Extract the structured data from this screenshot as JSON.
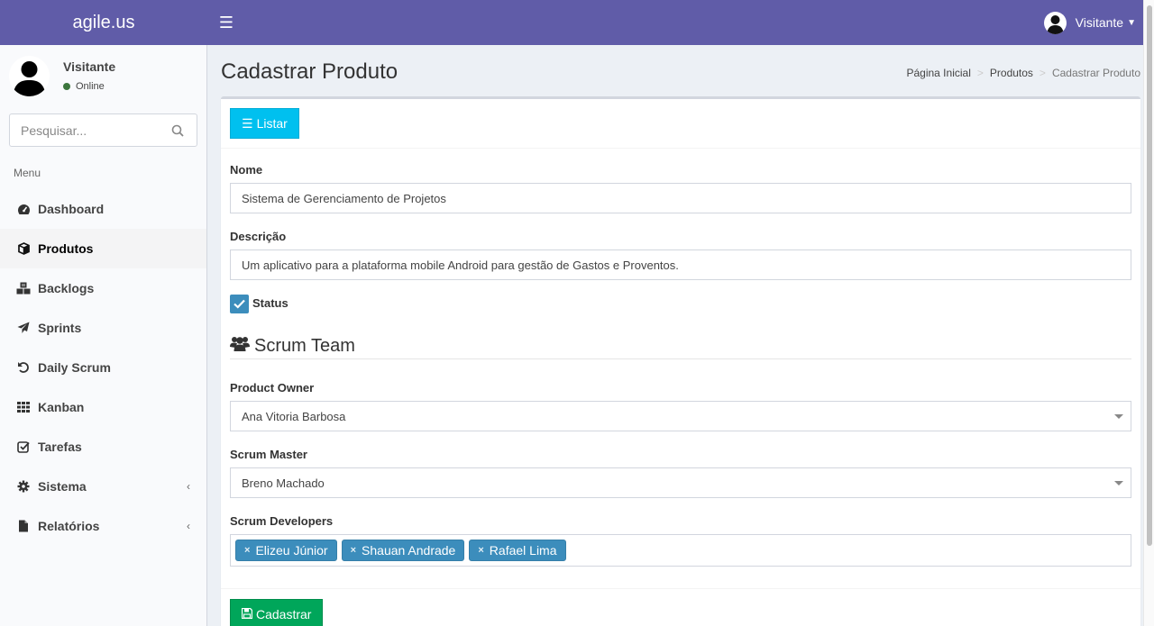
{
  "header": {
    "logo": "agile.us",
    "user_name": "Visitante"
  },
  "sidebar": {
    "user": {
      "name": "Visitante",
      "status": "Online"
    },
    "search_placeholder": "Pesquisar...",
    "menu_header": "Menu",
    "items": [
      {
        "label": "Dashboard",
        "icon": "dashboard-icon"
      },
      {
        "label": "Produtos",
        "icon": "cube-icon",
        "active": true
      },
      {
        "label": "Backlogs",
        "icon": "cubes-icon"
      },
      {
        "label": "Sprints",
        "icon": "paper-plane-icon"
      },
      {
        "label": "Daily Scrum",
        "icon": "undo-icon"
      },
      {
        "label": "Kanban",
        "icon": "grid-icon"
      },
      {
        "label": "Tarefas",
        "icon": "check-square-icon"
      },
      {
        "label": "Sistema",
        "icon": "gear-icon",
        "submenu": true
      },
      {
        "label": "Relatórios",
        "icon": "file-icon",
        "submenu": true
      }
    ]
  },
  "page": {
    "title": "Cadastrar Produto",
    "breadcrumb": [
      "Página Inicial",
      "Produtos",
      "Cadastrar Produto"
    ]
  },
  "form": {
    "list_button": "Listar",
    "name_label": "Nome",
    "name_value": "Sistema de Gerenciamento de Projetos",
    "desc_label": "Descrição",
    "desc_value": "Um aplicativo para a plataforma mobile Android para gestão de Gastos e Proventos.",
    "status_label": "Status",
    "status_checked": true,
    "team_title": "Scrum Team",
    "po_label": "Product Owner",
    "po_value": "Ana Vitoria Barbosa",
    "sm_label": "Scrum Master",
    "sm_value": "Breno Machado",
    "dev_label": "Scrum Developers",
    "developers": [
      "Elizeu Júnior",
      "Shauan Andrade",
      "Rafael Lima"
    ],
    "submit_button": "Cadastrar"
  },
  "colors": {
    "header": "#605ca8",
    "info": "#00c0ef",
    "success": "#00a65a",
    "primary": "#3c8dbc"
  }
}
